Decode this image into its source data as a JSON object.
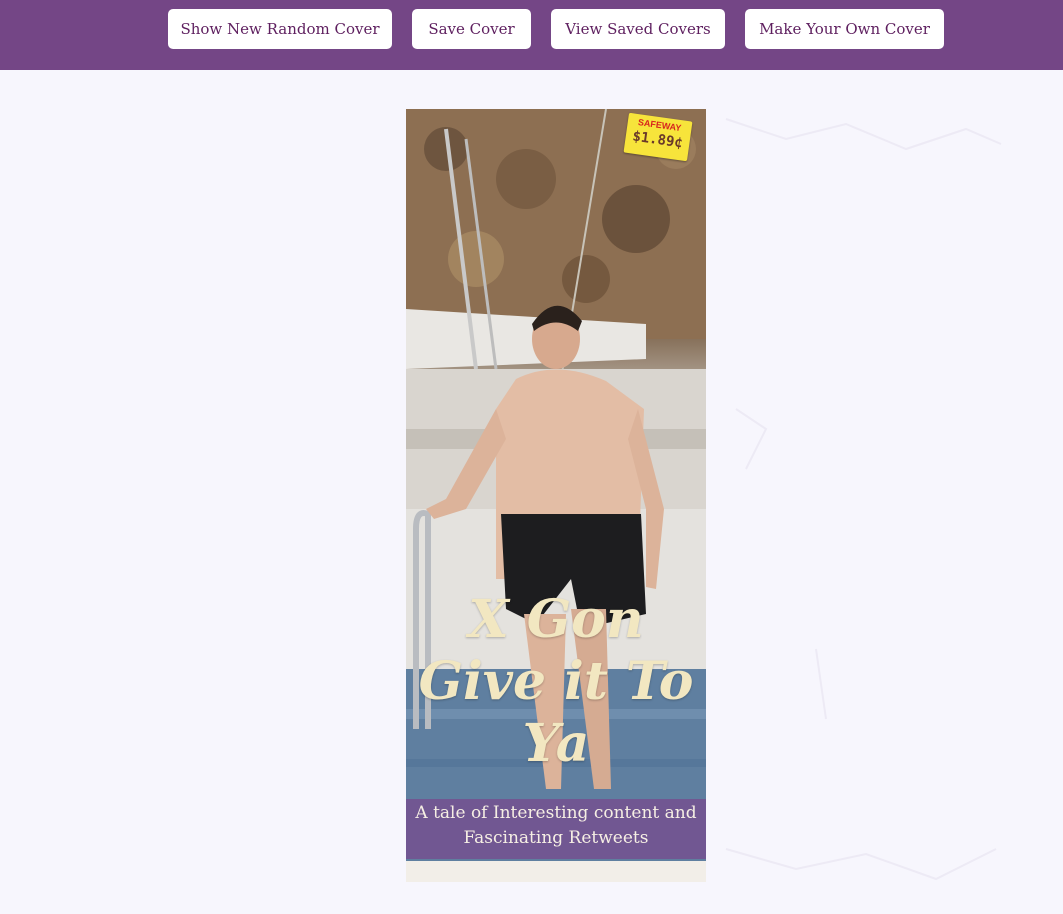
{
  "toolbar": {
    "random_label": "Show New Random Cover",
    "save_label": "Save Cover",
    "view_saved_label": "View Saved Covers",
    "make_own_label": "Make Your Own Cover"
  },
  "cover": {
    "price_store": "SAFEWAY",
    "price_value": "$1.89¢",
    "title": "X Gon Give it To Ya",
    "tagline": "A tale of Interesting content and Fascinating Retweets"
  },
  "colors": {
    "header": "#744686",
    "background": "#f7f6fd",
    "button_text": "#5e1f5f",
    "title_text": "#f2e7c1"
  }
}
